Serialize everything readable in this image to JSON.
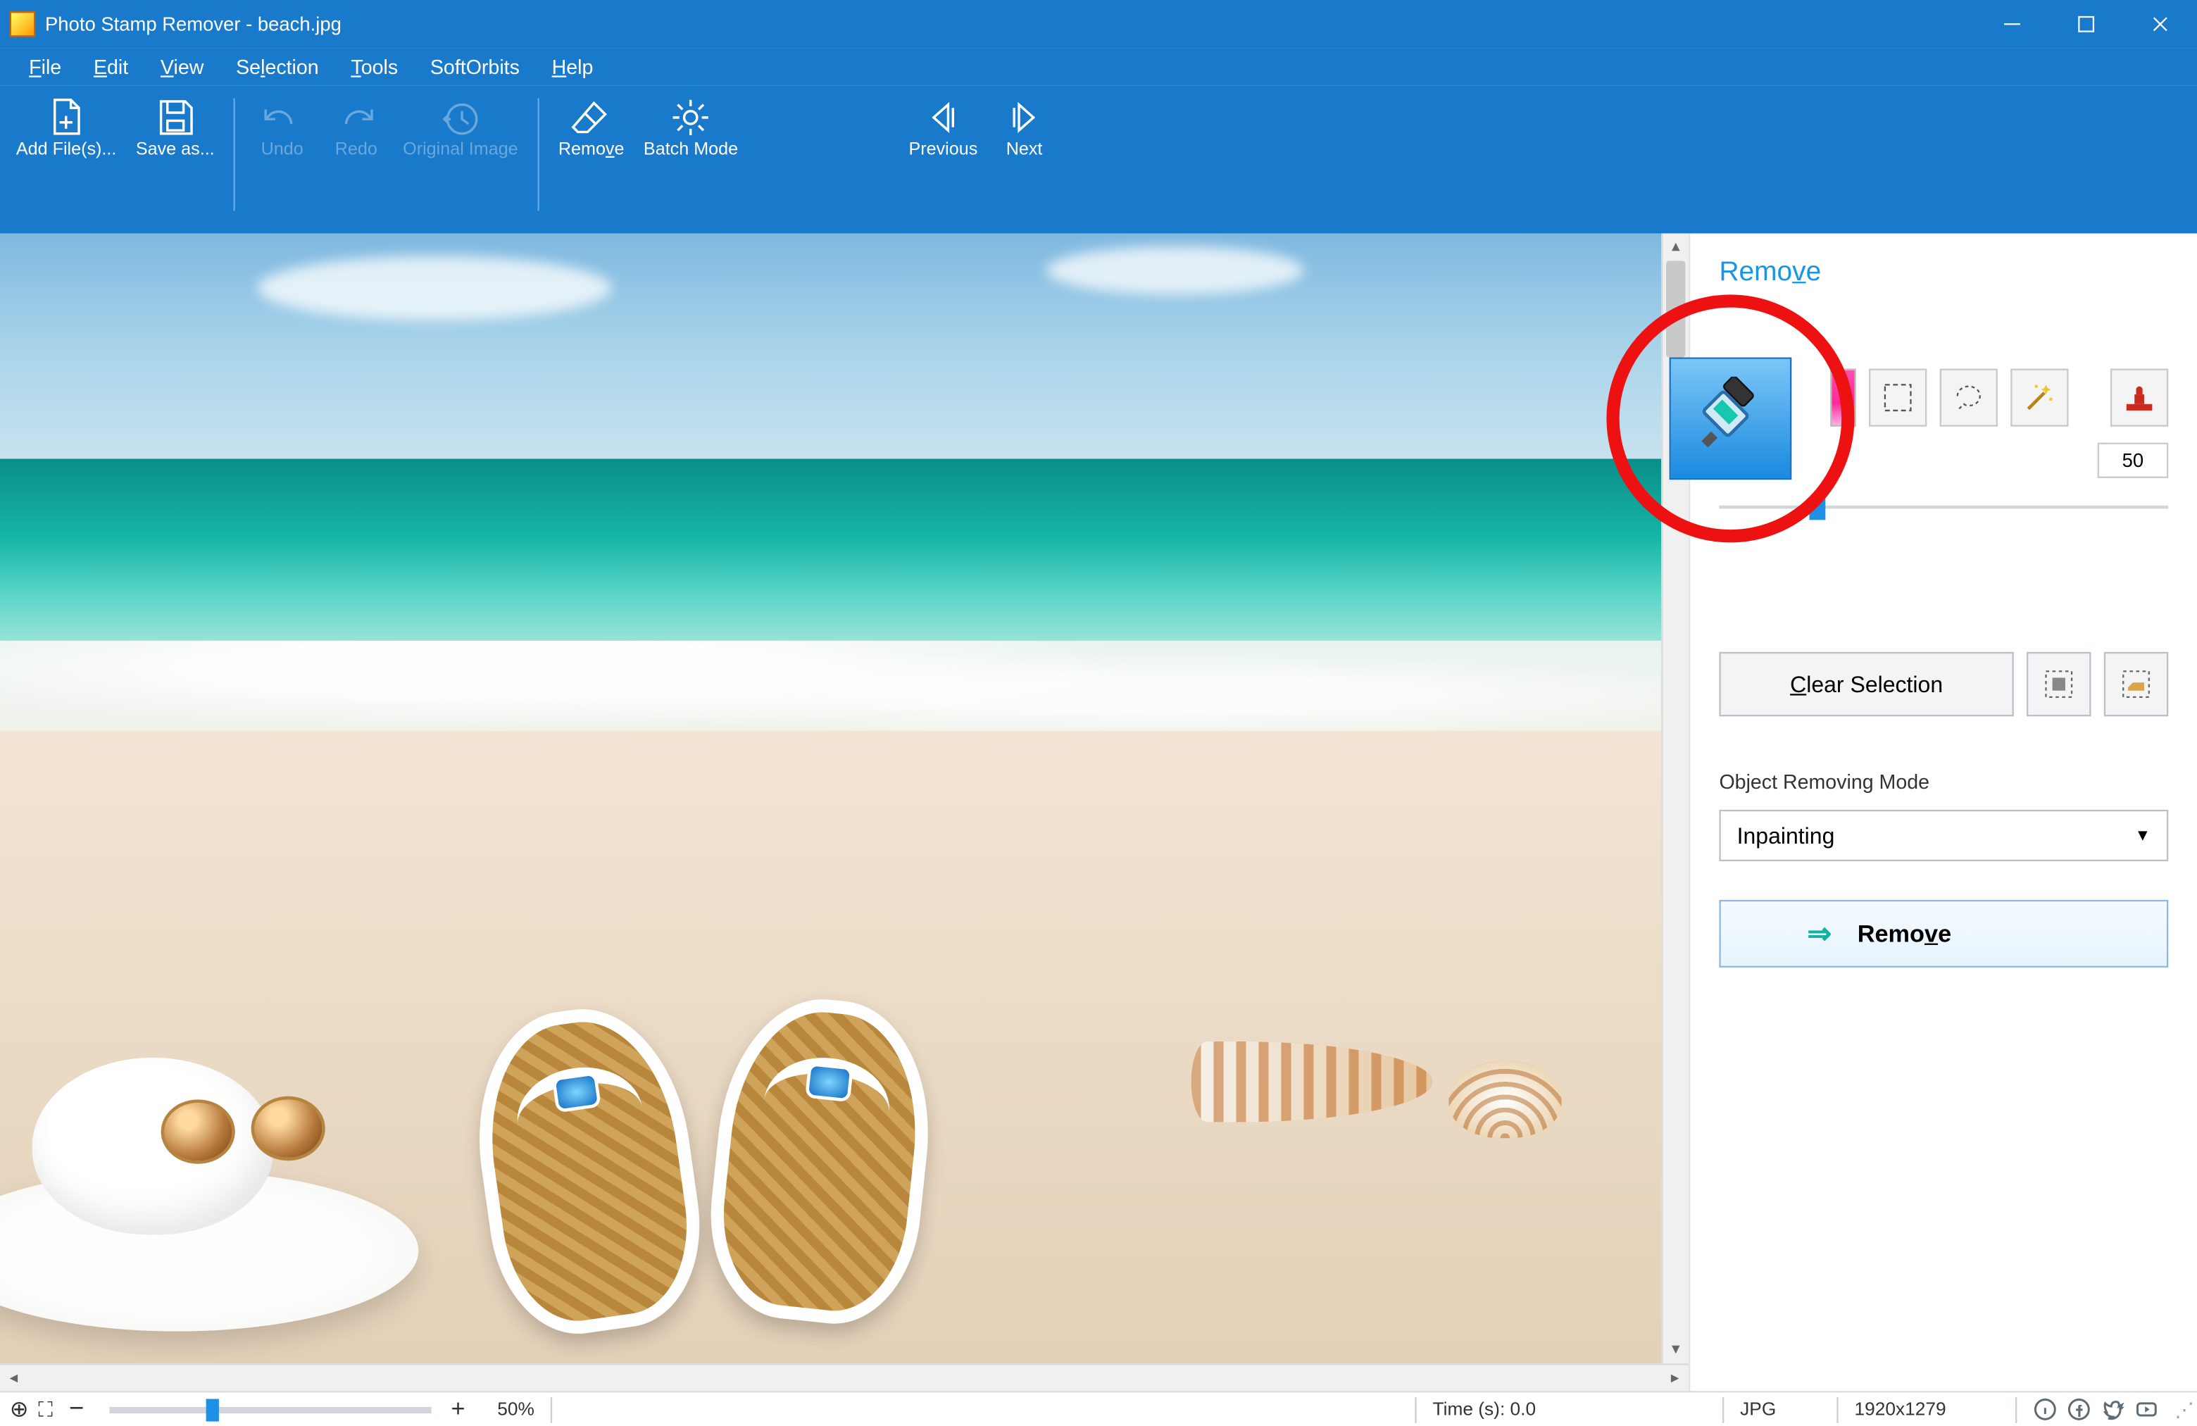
{
  "window": {
    "title": "Photo Stamp Remover - beach.jpg"
  },
  "menu": {
    "file": "File",
    "edit": "Edit",
    "view": "View",
    "selection": "Selection",
    "tools": "Tools",
    "softorbits": "SoftOrbits",
    "help": "Help"
  },
  "toolbar": {
    "add_files": "Add File(s)...",
    "save_as": "Save as...",
    "undo": "Undo",
    "redo": "Redo",
    "original": "Original Image",
    "remove": "Remove",
    "batch": "Batch Mode",
    "previous": "Previous",
    "next": "Next"
  },
  "side": {
    "heading": "Remove",
    "brush_size": "50",
    "clear_selection": "Clear Selection",
    "mode_label": "Object Removing Mode",
    "mode_value": "Inpainting",
    "remove_button": "Remove"
  },
  "status": {
    "zoom_pct": "50%",
    "time": "Time (s): 0.0",
    "format": "JPG",
    "dimensions": "1920x1279"
  }
}
